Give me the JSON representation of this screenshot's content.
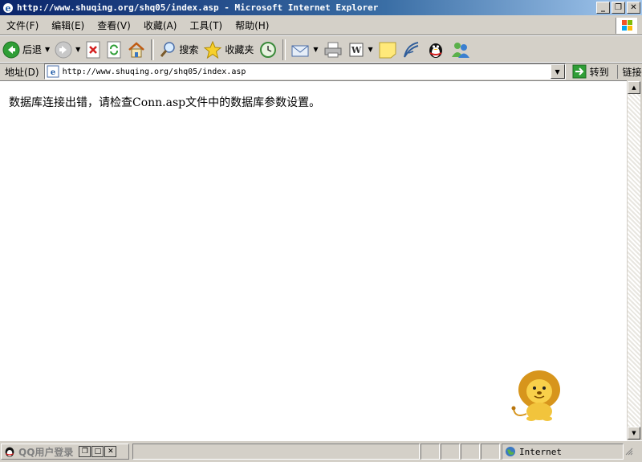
{
  "window": {
    "title": "http://www.shuqing.org/shq05/index.asp - Microsoft Internet Explorer",
    "buttons": {
      "minimize": "_",
      "maximize": "❐",
      "close": "✕"
    }
  },
  "menu": [
    "文件(F)",
    "编辑(E)",
    "查看(V)",
    "收藏(A)",
    "工具(T)",
    "帮助(H)"
  ],
  "toolbar": {
    "back_label": "后退",
    "search_label": "搜索",
    "favorites_label": "收藏夹"
  },
  "address": {
    "label": "地址(D)",
    "url": "http://www.shuqing.org/shq05/index.asp",
    "go_label": "转到",
    "links_label": "链接"
  },
  "page": {
    "message": "数据库连接出错，请检查Conn.asp文件中的数据库参数设置。"
  },
  "statusbar": {
    "qq_label": "QQ用户登录",
    "zone_label": "Internet"
  },
  "colors": {
    "title_start": "#0a246a",
    "title_end": "#a6caf0",
    "chrome": "#d4d0c8"
  }
}
